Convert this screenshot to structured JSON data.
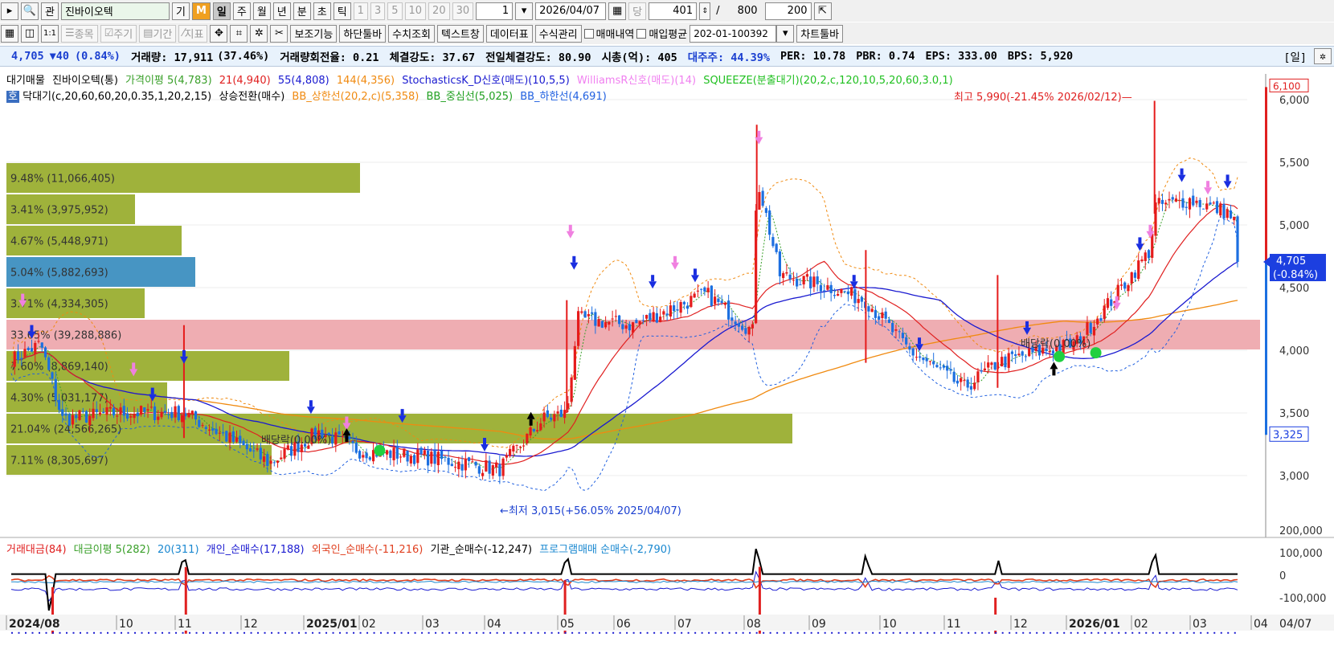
{
  "toolbar1": {
    "search_icon": "magnifier-icon",
    "kwan_label": "관",
    "stock_name": "진바이오텍",
    "gi_label": "기",
    "m_label": "M",
    "periods": [
      "일",
      "주",
      "월",
      "년",
      "분",
      "초",
      "틱"
    ],
    "intervals": [
      "1",
      "3",
      "5",
      "10",
      "20",
      "30"
    ],
    "interval_value": "1",
    "date": "2026/04/07",
    "dang_label": "당",
    "count_value": "401",
    "slash": "/",
    "total": "800",
    "view_count": "200"
  },
  "toolbar2": {
    "jongmok": "종목",
    "jugi": "주기",
    "gigan": "기간",
    "jipyo": "지표",
    "bojo": "보조기능",
    "hadan": "하단툴바",
    "suchi": "수치조회",
    "text": "텍스트창",
    "datatable": "데이터표",
    "formula": "수식관리",
    "trade_hist": "매매내역",
    "buy_avg": "매입평균",
    "account": "202-01-100392",
    "chart_toolbar": "차트툴바"
  },
  "info": {
    "price": "4,705",
    "change": "▼40",
    "change_pct": "(0.84%)",
    "volume": "거래량: 17,911",
    "volume_pct": "(37.46%)",
    "turnover": "거래량회전율: 0.21",
    "strength": "체결강도: 37.67",
    "prev_strength": "전일체결강도: 80.90",
    "mcap": "시총(억): 405",
    "major": "대주주: 44.39%",
    "per": "PER: 10.78",
    "pbr": "PBR: 0.74",
    "eps": "EPS: 333.00",
    "bps": "BPS: 5,920",
    "period": "[일]"
  },
  "legend1": [
    {
      "text": "대기매물",
      "color": "#000000"
    },
    {
      "text": "진바이오텍(통)",
      "color": "#000000"
    },
    {
      "text": "가격이평 5(4,783)",
      "color": "#3aa02a"
    },
    {
      "text": "21(4,940)",
      "color": "#e02020"
    },
    {
      "text": "55(4,808)",
      "color": "#1a1ad0"
    },
    {
      "text": "144(4,356)",
      "color": "#f08a10"
    },
    {
      "text": "StochasticsK_D신호(매도)(10,5,5)",
      "color": "#1a1ad0"
    },
    {
      "text": "WilliamsR신호(매도)(14)",
      "color": "#f080f0"
    },
    {
      "text": "SQUEEZE(분출대기)(20,2,c,120,10,5,20,60,3.0,1)",
      "color": "#20c020"
    }
  ],
  "legend2": [
    {
      "text": "호",
      "color": "#ffffff"
    },
    {
      "text": "닥대기(c,20,60,60,20,0.35,1,20,2,15)",
      "color": "#000000"
    },
    {
      "text": "상승전환(매수)",
      "color": "#000000"
    },
    {
      "text": "BB_상한선(20,2,c)(5,358)",
      "color": "#f08a10"
    },
    {
      "text": "BB_중심선(5,025)",
      "color": "#20a020"
    },
    {
      "text": "BB_하한선(4,691)",
      "color": "#2060e0"
    }
  ],
  "vp_bars": [
    {
      "label": "9.48% (11,066,405)",
      "lo": 5250,
      "hi": 5500,
      "color": "#9aae30"
    },
    {
      "label": "3.41% (3,975,952)",
      "lo": 5000,
      "hi": 5250,
      "color": "#9aae30"
    },
    {
      "label": "4.67% (5,448,971)",
      "lo": 4750,
      "hi": 5000,
      "color": "#9aae30"
    },
    {
      "label": "5.04% (5,882,693)",
      "lo": 4500,
      "hi": 4750,
      "color": "#3d8fc0"
    },
    {
      "label": "3.71% (4,334,305)",
      "lo": 4250,
      "hi": 4500,
      "color": "#9aae30"
    },
    {
      "label": "33.65% (39,288,886)",
      "lo": 4000,
      "hi": 4250,
      "color": "#e88a92"
    },
    {
      "label": "7.60% (8,869,140)",
      "lo": 3750,
      "hi": 4000,
      "color": "#9aae30"
    },
    {
      "label": "4.30% (5,031,177)",
      "lo": 3500,
      "hi": 3750,
      "color": "#9aae30"
    },
    {
      "label": "21.04% (24,566,265)",
      "lo": 3250,
      "hi": 3500,
      "color": "#9aae30"
    },
    {
      "label": "7.11% (8,305,697)",
      "lo": 3000,
      "hi": 3250,
      "color": "#9aae30"
    }
  ],
  "annotations": {
    "high": "최고 5,990(-21.45% 2026/02/12)",
    "low": "←최저 3,015(+56.05% 2025/04/07)",
    "div1": "배당락(0.00%)",
    "div2": "배당락(0.00%)"
  },
  "price_axis": {
    "ticks": [
      6000,
      5500,
      5000,
      4500,
      4000,
      3500,
      3000
    ],
    "tick_labels": [
      "6,000",
      "5,500",
      "5,000",
      "4,500",
      "4,000",
      "3,500",
      "3,000"
    ],
    "max": 6100,
    "min": 2760,
    "current_label": "4,705",
    "current_change": "(-0.84%)",
    "top_label": "6,100",
    "bottom_label": "3,325"
  },
  "lower_legend": [
    {
      "text": "거래대금(84)",
      "color": "#e02020"
    },
    {
      "text": "대금이평 5(282)",
      "color": "#3aa02a"
    },
    {
      "text": "20(311)",
      "color": "#1a88d0"
    },
    {
      "text": "개인_순매수(17,188)",
      "color": "#1a1ad0"
    },
    {
      "text": "외국인_순매수(-11,216)",
      "color": "#e04020"
    },
    {
      "text": "기관_순매수(-12,247)",
      "color": "#000000"
    },
    {
      "text": "프로그램매매 순매수(-2,790)",
      "color": "#1a88d0"
    }
  ],
  "lower_axis": {
    "ticks": [
      "200,000",
      "100,000",
      "0",
      "-100,000",
      "-200,000"
    ]
  },
  "x_axis": {
    "labels": [
      "2024/08",
      "10",
      "11",
      "12",
      "2025/01",
      "02",
      "03",
      "04",
      "05",
      "06",
      "07",
      "08",
      "09",
      "10",
      "11",
      "12",
      "2026/01",
      "02",
      "03",
      "04"
    ],
    "current_date": "04/07"
  },
  "colors": {
    "up": "#e51b1b",
    "down": "#1c6fe0",
    "ma5": "#3aa02a",
    "ma21": "#e02020",
    "ma55": "#1a1ad0",
    "ma144": "#f08a10"
  },
  "chart_data": {
    "type": "candlestick",
    "title": "진바이오텍",
    "y_range": [
      2760,
      6100
    ],
    "checkpoints": [
      {
        "date": "2024-08-01",
        "close": 3900
      },
      {
        "date": "2024-08-20",
        "close": 4050
      },
      {
        "date": "2024-09-01",
        "close": 3450
      },
      {
        "date": "2024-10-01",
        "close": 3500
      },
      {
        "date": "2024-11-05",
        "close": 3500
      },
      {
        "date": "2024-11-25",
        "close": 3300
      },
      {
        "date": "2024-12-15",
        "close": 3100
      },
      {
        "date": "2025-01-10",
        "close": 3350
      },
      {
        "date": "2025-02-01",
        "close": 3200
      },
      {
        "date": "2025-03-01",
        "close": 3150
      },
      {
        "date": "2025-04-07",
        "close": 3050
      },
      {
        "date": "2025-04-25",
        "close": 3450
      },
      {
        "date": "2025-05-06",
        "close": 3500
      },
      {
        "date": "2025-05-12",
        "close": 4250
      },
      {
        "date": "2025-06-10",
        "close": 4200
      },
      {
        "date": "2025-07-15",
        "close": 4450
      },
      {
        "date": "2025-08-05",
        "close": 4150
      },
      {
        "date": "2025-08-07",
        "close": 5400
      },
      {
        "date": "2025-08-18",
        "close": 4600
      },
      {
        "date": "2025-09-10",
        "close": 4500
      },
      {
        "date": "2025-09-25",
        "close": 4400
      },
      {
        "date": "2025-10-15",
        "close": 4000
      },
      {
        "date": "2025-11-10",
        "close": 3700
      },
      {
        "date": "2025-11-25",
        "close": 3900
      },
      {
        "date": "2025-12-20",
        "close": 4000
      },
      {
        "date": "2026-01-05",
        "close": 4050
      },
      {
        "date": "2026-01-25",
        "close": 4450
      },
      {
        "date": "2026-02-10",
        "close": 4800
      },
      {
        "date": "2026-02-12",
        "close": 5150
      },
      {
        "date": "2026-03-01",
        "close": 5200
      },
      {
        "date": "2026-03-20",
        "close": 5100
      },
      {
        "date": "2026-04-07",
        "close": 4705
      }
    ],
    "ma_levels": {
      "ma5": 4783,
      "ma21": 4940,
      "ma55": 4808,
      "ma144": 4356
    },
    "bb": {
      "upper": 5358,
      "mid": 5025,
      "lower": 4691
    }
  }
}
